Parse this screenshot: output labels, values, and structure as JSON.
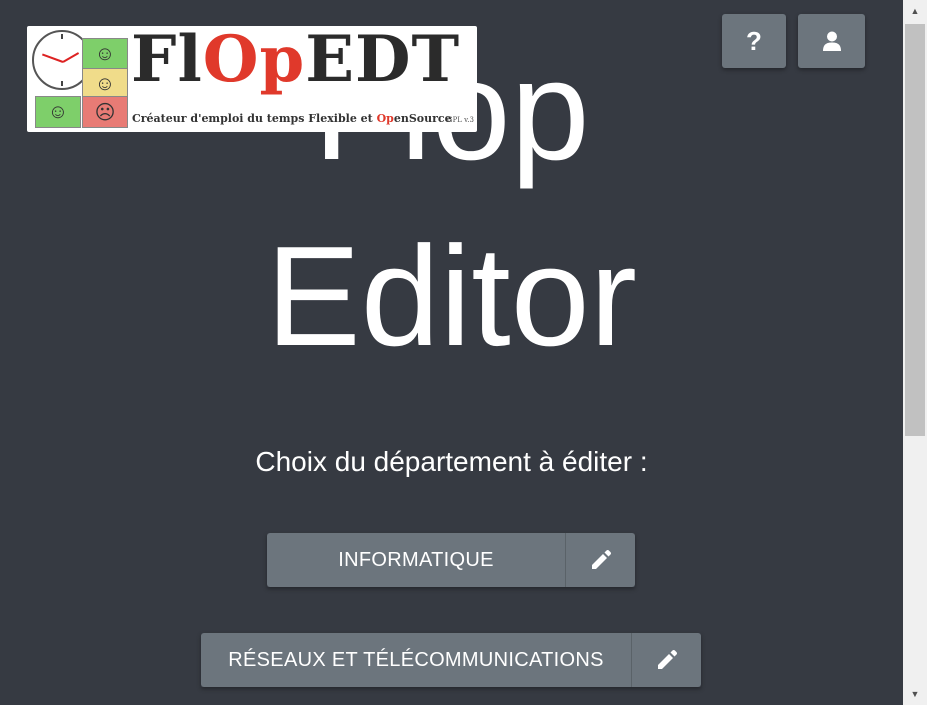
{
  "page": {
    "title_line1": "Flop",
    "title_line2": "Editor",
    "subtitle": "Choix du département à éditer :"
  },
  "logo": {
    "word_prefix": "Fl",
    "word_red": "Op",
    "word_suffix": "EDT",
    "tagline_start": "Créateur d'emploi du temps Flexible et ",
    "tagline_red": "Op",
    "tagline_end": "enSource",
    "license": "GPL v.3"
  },
  "header": {
    "help_label": "?",
    "help_icon": "question-icon",
    "user_icon": "user-icon"
  },
  "departments": [
    {
      "label": "INFORMATIQUE",
      "edit_icon": "pencil-icon"
    },
    {
      "label": "RÉSEAUX ET TÉLÉCOMMUNICATIONS",
      "edit_icon": "pencil-icon"
    }
  ],
  "colors": {
    "background": "#363a42",
    "button": "#6c757d",
    "accent_red": "#e0392b"
  }
}
